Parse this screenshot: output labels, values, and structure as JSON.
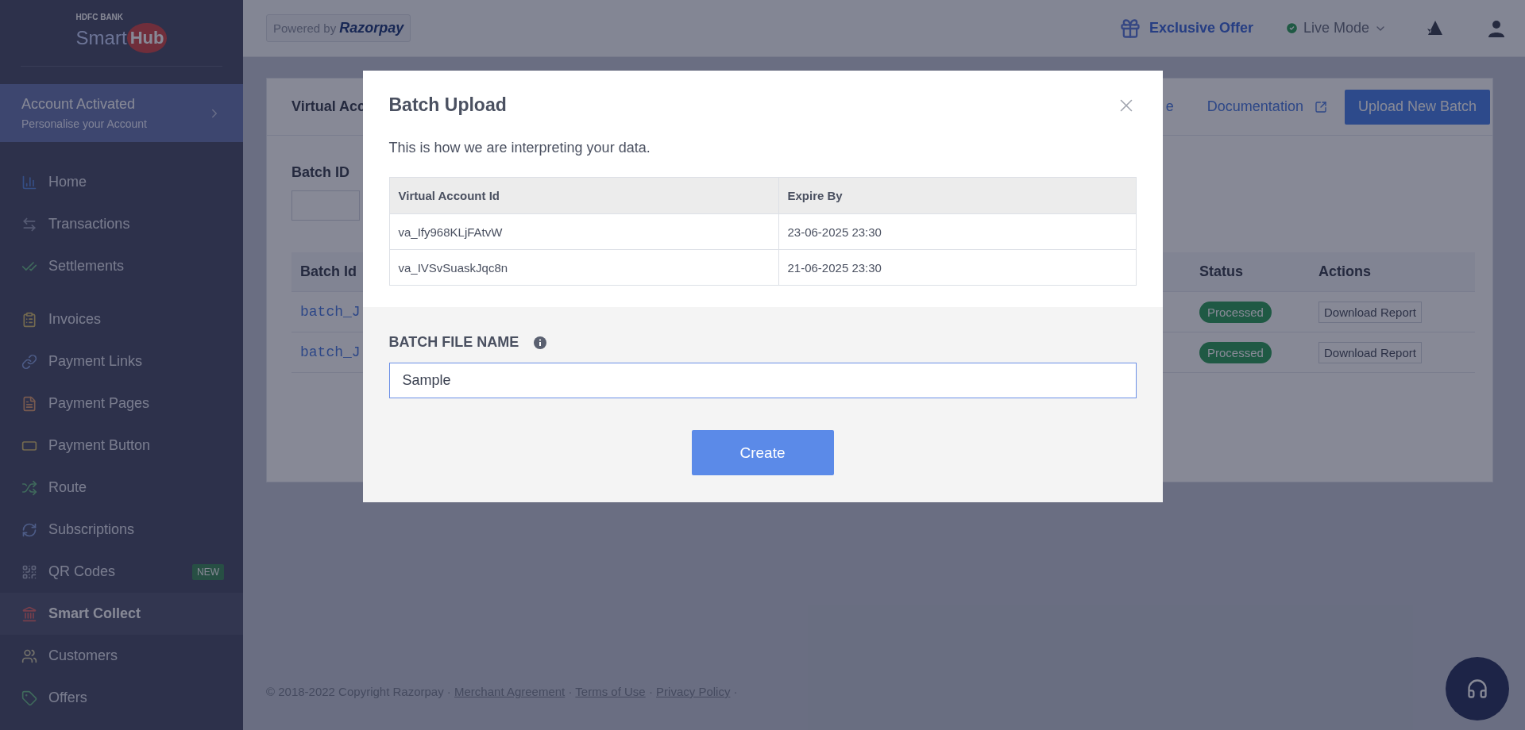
{
  "sidebar": {
    "logo": {
      "bank": "HDFC BANK",
      "word": "Smart",
      "hub": "Hub"
    },
    "account_banner": {
      "title": "Account Activated",
      "subtitle": "Personalise your Account"
    },
    "groups": [
      [
        {
          "label": "Home",
          "kind": "home",
          "selected": false
        },
        {
          "label": "Transactions",
          "kind": "transactions",
          "selected": false
        },
        {
          "label": "Settlements",
          "kind": "settlements",
          "selected": false
        }
      ],
      [
        {
          "label": "Invoices",
          "kind": "invoices",
          "selected": false
        },
        {
          "label": "Payment Links",
          "kind": "links",
          "selected": false
        },
        {
          "label": "Payment Pages",
          "kind": "pages",
          "selected": false
        },
        {
          "label": "Payment Button",
          "kind": "button",
          "selected": false
        },
        {
          "label": "Route",
          "kind": "route",
          "selected": false
        },
        {
          "label": "Subscriptions",
          "kind": "subscriptions",
          "selected": false
        },
        {
          "label": "QR Codes",
          "kind": "qr",
          "selected": false,
          "badge": "NEW"
        },
        {
          "label": "Smart Collect",
          "kind": "bank",
          "selected": true
        },
        {
          "label": "Customers",
          "kind": "customers",
          "selected": false
        },
        {
          "label": "Offers",
          "kind": "offers",
          "selected": false
        }
      ]
    ]
  },
  "header": {
    "powered_by": "Powered by",
    "brand": "Razorpay",
    "offer": "Exclusive Offer",
    "mode": "Live Mode"
  },
  "page": {
    "title": "Virtual Acc",
    "link_fragment": "e",
    "documentation": "Documentation",
    "upload_button": "Upload New Batch",
    "filter_label": "Batch ID",
    "table": {
      "columns": [
        "Batch Id",
        "Status",
        "Actions"
      ],
      "rows": [
        {
          "batch_id": "batch_J",
          "status": "Processed",
          "action": "Download Report"
        },
        {
          "batch_id": "batch_J",
          "status": "Processed",
          "action": "Download Report"
        }
      ]
    }
  },
  "modal": {
    "title": "Batch Upload",
    "description": "This is how we are interpreting your data.",
    "table": {
      "columns": [
        "Virtual Account Id",
        "Expire By"
      ],
      "rows": [
        [
          "va_Ify968KLjFAtvW",
          "23-06-2025 23:30"
        ],
        [
          "va_IVSvSuaskJqc8n",
          "21-06-2025 23:30"
        ]
      ]
    },
    "field_label": "BATCH FILE NAME",
    "field_value": "Sample",
    "submit": "Create"
  },
  "footer": {
    "copyright": "© 2018-2022 Copyright Razorpay",
    "separator": "·",
    "links": [
      "Merchant Agreement",
      "Terms of Use",
      "Privacy Policy"
    ]
  }
}
